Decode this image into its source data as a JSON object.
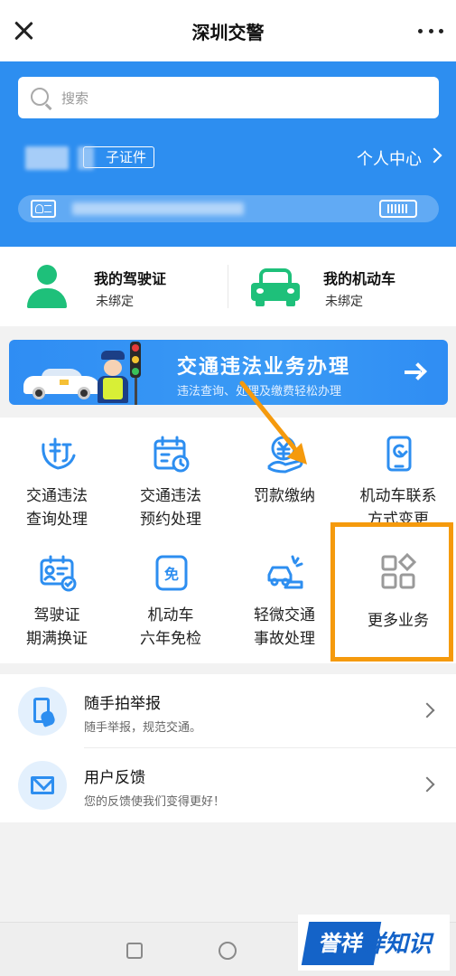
{
  "header": {
    "title": "深圳交警"
  },
  "search": {
    "placeholder": "搜索"
  },
  "account": {
    "cert_tag": "子证件",
    "personal_center": "个人中心"
  },
  "license": {
    "driver": {
      "title": "我的驾驶证",
      "status": "未绑定"
    },
    "vehicle": {
      "title": "我的机动车",
      "status": "未绑定"
    }
  },
  "banner": {
    "title": "交通违法业务办理",
    "subtitle": "违法查询、处理及缴费轻松办理"
  },
  "services": [
    {
      "label": [
        "交通违法",
        "查询处理"
      ],
      "icon": "violation-icon"
    },
    {
      "label": [
        "交通违法",
        "预约处理"
      ],
      "icon": "calendar-icon"
    },
    {
      "label": [
        "罚款缴纳"
      ],
      "icon": "fine-payment-icon"
    },
    {
      "label": [
        "机动车联系",
        "方式变更"
      ],
      "icon": "phone-change-icon"
    },
    {
      "label": [
        "驾驶证",
        "期满换证"
      ],
      "icon": "license-renew-icon"
    },
    {
      "label": [
        "机动车",
        "六年免检"
      ],
      "icon": "exempt-icon"
    },
    {
      "label": [
        "轻微交通",
        "事故处理"
      ],
      "icon": "accident-icon"
    },
    {
      "label": [
        "更多业务"
      ],
      "icon": "more-apps-icon"
    }
  ],
  "list": [
    {
      "title": "随手拍举报",
      "subtitle": "随手举报，规范交通。"
    },
    {
      "title": "用户反馈",
      "subtitle": "您的反馈使我们变得更好！"
    }
  ],
  "watermark": {
    "badge": "誉祥",
    "text": "祥知识"
  },
  "colors": {
    "brand_blue": "#2d8ef0",
    "green": "#1ec07a",
    "highlight_orange": "#f59a0d"
  }
}
